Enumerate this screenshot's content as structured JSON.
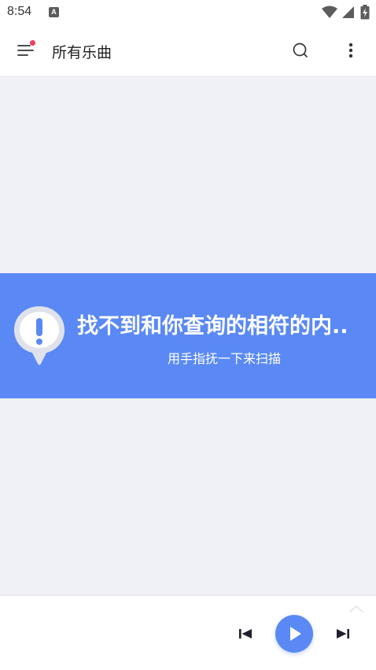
{
  "status_bar": {
    "time": "8:54",
    "notification_letter": "A",
    "icons": [
      "a-icon",
      "wifi-icon",
      "signal-icon",
      "battery-icon"
    ]
  },
  "app_bar": {
    "title": "所有乐曲",
    "icons": [
      "menu-icon",
      "search-icon",
      "more-vert-icon"
    ],
    "menu_badge_color": "#ef3d5a"
  },
  "empty_state": {
    "title": "找不到和你查询的相符的内..",
    "subtitle": "用手指抚一下来扫描",
    "icon": "alert-bubble-icon",
    "background_color": "#5a89f5"
  },
  "player": {
    "icons": [
      "chevron-up-icon",
      "skip-previous-icon",
      "play-icon",
      "skip-next-icon"
    ],
    "accent_color": "#5a89f5"
  },
  "colors": {
    "content_background": "#f0f1f6",
    "bar_background": "#ffffff"
  }
}
